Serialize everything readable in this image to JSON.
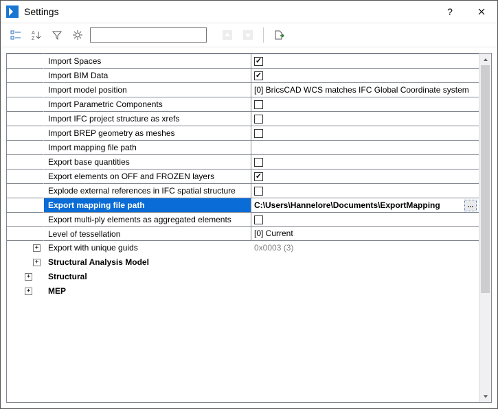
{
  "window": {
    "title": "Settings",
    "help": "?",
    "close": "✕"
  },
  "toolbar": {
    "search_value": ""
  },
  "rows": [
    {
      "kind": "data",
      "name": "Import Spaces",
      "valueType": "check",
      "checked": true
    },
    {
      "kind": "data",
      "name": "Import BIM Data",
      "valueType": "check",
      "checked": true
    },
    {
      "kind": "data",
      "name": "Import model position",
      "valueType": "text",
      "value": "[0] BricsCAD WCS matches IFC Global Coordinate system"
    },
    {
      "kind": "data",
      "name": "Import Parametric Components",
      "valueType": "check",
      "checked": false
    },
    {
      "kind": "data",
      "name": "Import IFC project structure as xrefs",
      "valueType": "check",
      "checked": false
    },
    {
      "kind": "data",
      "name": "Import BREP geometry as meshes",
      "valueType": "check",
      "checked": false
    },
    {
      "kind": "data",
      "name": "Import mapping file path",
      "valueType": "text",
      "value": ""
    },
    {
      "kind": "data",
      "name": "Export base quantities",
      "valueType": "check",
      "checked": false
    },
    {
      "kind": "data",
      "name": "Export elements on OFF and FROZEN layers",
      "valueType": "check",
      "checked": true
    },
    {
      "kind": "data",
      "name": "Explode external references in IFC spatial structure",
      "valueType": "check",
      "checked": false
    },
    {
      "kind": "data",
      "name": "Export mapping file path",
      "valueType": "path",
      "value": "C:\\Users\\Hannelore\\Documents\\ExportMapping",
      "selected": true,
      "browse": "..."
    },
    {
      "kind": "data",
      "name": "Export multi-ply elements as aggregated elements",
      "valueType": "check",
      "checked": false
    },
    {
      "kind": "data",
      "name": "Level of tessellation",
      "valueType": "text",
      "value": "[0] Current",
      "last": true
    },
    {
      "kind": "group",
      "name": "Export with unique guids",
      "valueType": "text",
      "value": "0x0003 (3)",
      "dim": true,
      "indent": 1
    },
    {
      "kind": "group",
      "name": "Structural Analysis Model",
      "valueType": "none",
      "bold": true,
      "indent": 1
    },
    {
      "kind": "group",
      "name": "Structural",
      "valueType": "none",
      "bold": true,
      "indent": 0
    },
    {
      "kind": "group",
      "name": "MEP",
      "valueType": "none",
      "bold": true,
      "indent": 0
    }
  ]
}
